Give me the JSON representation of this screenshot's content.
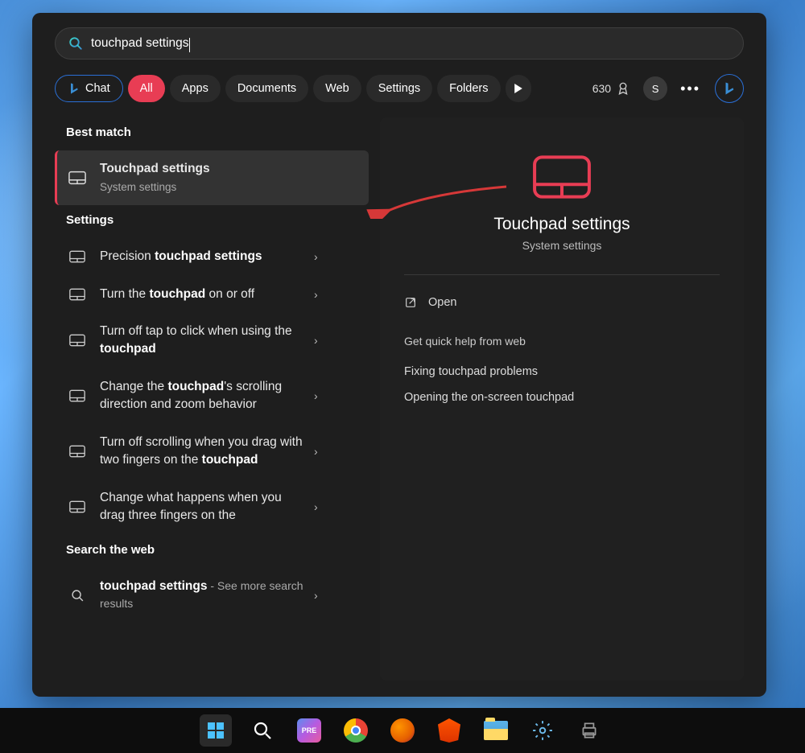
{
  "search": {
    "query": "touchpad settings"
  },
  "filters": {
    "chat": "Chat",
    "all": "All",
    "apps": "Apps",
    "documents": "Documents",
    "web": "Web",
    "settings": "Settings",
    "folders": "Folders"
  },
  "rewards": {
    "points": "630"
  },
  "avatar": {
    "initial": "S"
  },
  "sections": {
    "best_match": "Best match",
    "settings": "Settings",
    "search_web": "Search the web"
  },
  "best_match_item": {
    "title": "Touchpad settings",
    "subtitle": "System settings"
  },
  "settings_items": [
    {
      "pre": "Precision ",
      "bold": "touchpad settings",
      "post": ""
    },
    {
      "pre": "Turn the ",
      "bold": "touchpad",
      "post": " on or off"
    },
    {
      "pre": "Turn off tap to click when using the ",
      "bold": "touchpad",
      "post": ""
    },
    {
      "pre": "Change the ",
      "bold": "touchpad",
      "post": "'s scrolling direction and zoom behavior"
    },
    {
      "pre": "Turn off scrolling when you drag with two fingers on the ",
      "bold": "touchpad",
      "post": ""
    },
    {
      "pre": "Change what happens when you drag three fingers on the",
      "bold": "",
      "post": ""
    }
  ],
  "web_item": {
    "bold": "touchpad settings",
    "suffix": " - See more search results"
  },
  "preview": {
    "title": "Touchpad settings",
    "subtitle": "System settings",
    "open": "Open",
    "help_header": "Get quick help from web",
    "help_links": [
      "Fixing touchpad problems",
      "Opening the on-screen touchpad"
    ]
  },
  "colors": {
    "accent_red": "#e83d54",
    "accent_blue": "#2a6fd6"
  }
}
